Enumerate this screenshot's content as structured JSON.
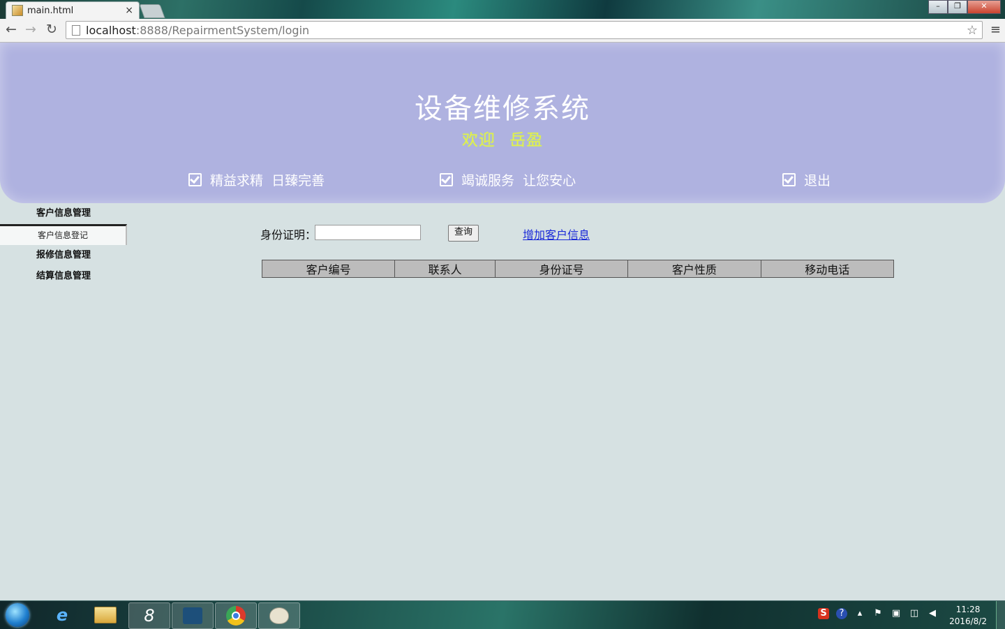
{
  "browser": {
    "tab_title": "main.html",
    "tab_close": "×",
    "url_host": "localhost",
    "url_path": ":8888/RepairmentSystem/login",
    "back": "←",
    "forward": "→",
    "reload": "↻",
    "star": "☆",
    "menu": "≡",
    "window_controls": {
      "minimize": "–",
      "maximize": "❐",
      "close": "✕"
    }
  },
  "header": {
    "title": "设备维修系统",
    "welcome": "欢迎",
    "user": "岳盈",
    "slogans": [
      "精益求精  日臻完善",
      "竭诚服务  让您安心"
    ],
    "logout": "退出"
  },
  "sidebar": {
    "items": [
      {
        "label": "客户信息管理",
        "type": "head"
      },
      {
        "label": "客户信息登记",
        "type": "sub"
      },
      {
        "label": "报修信息管理",
        "type": "head"
      },
      {
        "label": "结算信息管理",
        "type": "head"
      }
    ]
  },
  "search": {
    "label": "身份证明：",
    "value": "",
    "button": "查询",
    "add_link": "增加客户信息"
  },
  "table": {
    "columns": [
      "客户编号",
      "联系人",
      "身份证号",
      "客户性质",
      "移动电话"
    ]
  },
  "taskbar": {
    "time": "11:28",
    "date": "2016/8/2",
    "apps": [
      "ie-icon",
      "explorer-icon",
      "app-8-icon",
      "mysql-icon",
      "chrome-icon",
      "paint-icon"
    ]
  },
  "colors": {
    "header_bg": "#afb2e0",
    "page_bg": "#d6e1e2",
    "welcome_text": "#e5f048",
    "link": "#1a2ad8"
  }
}
